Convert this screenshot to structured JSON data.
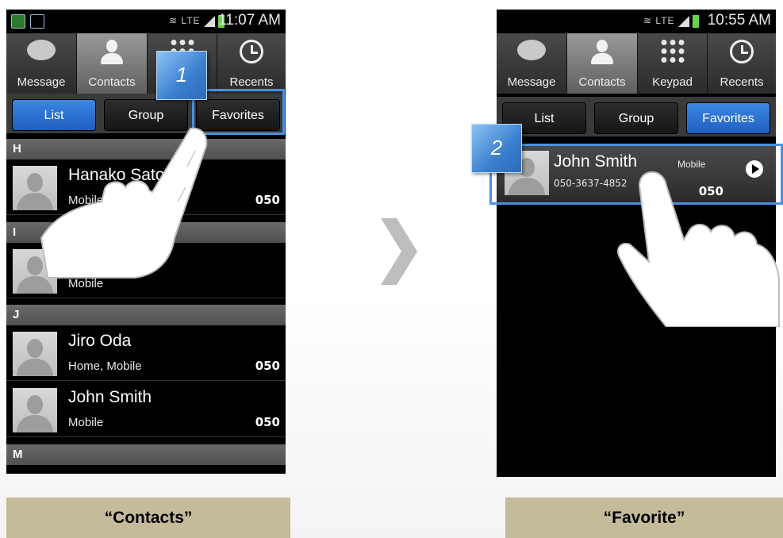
{
  "left_screen": {
    "status": {
      "time": "11:07 AM",
      "lte": "LTE"
    },
    "tabs": [
      {
        "label": "Message",
        "icon": "message-bubble-icon"
      },
      {
        "label": "Contacts",
        "icon": "person-icon"
      },
      {
        "label": "",
        "icon": "keypad-icon"
      },
      {
        "label": "Recents",
        "icon": "clock-icon"
      }
    ],
    "segments": [
      "List",
      "Group",
      "Favorites"
    ],
    "sections": [
      "H",
      "I",
      "J",
      "M"
    ],
    "contacts": [
      {
        "name": "Hanako Sato",
        "type": "Mobile",
        "call": "050"
      },
      {
        "name": "",
        "type": "Mobile",
        "call": ""
      },
      {
        "name": "Jiro Oda",
        "type": "Home, Mobile",
        "call": "050"
      },
      {
        "name": "John Smith",
        "type": "Mobile",
        "call": "050"
      }
    ],
    "step": "1",
    "caption": "“Contacts”"
  },
  "right_screen": {
    "status": {
      "time": "10:55 AM",
      "lte": "LTE"
    },
    "tabs": [
      {
        "label": "Message",
        "icon": "message-bubble-icon"
      },
      {
        "label": "Contacts",
        "icon": "person-icon"
      },
      {
        "label": "Keypad",
        "icon": "keypad-icon"
      },
      {
        "label": "Recents",
        "icon": "clock-icon"
      }
    ],
    "segments": [
      "List",
      "Group",
      "Favorites"
    ],
    "favorite": {
      "name": "John Smith",
      "phone": "050-3637-4852",
      "type": "Mobile",
      "call": "050"
    },
    "step": "2",
    "caption": "“Favorite”"
  },
  "colors": {
    "highlight": "#4b90e2",
    "active_segment": "#2a6fd0",
    "caption_bg": "#c4bb9b",
    "battery": "#6ad14b"
  }
}
